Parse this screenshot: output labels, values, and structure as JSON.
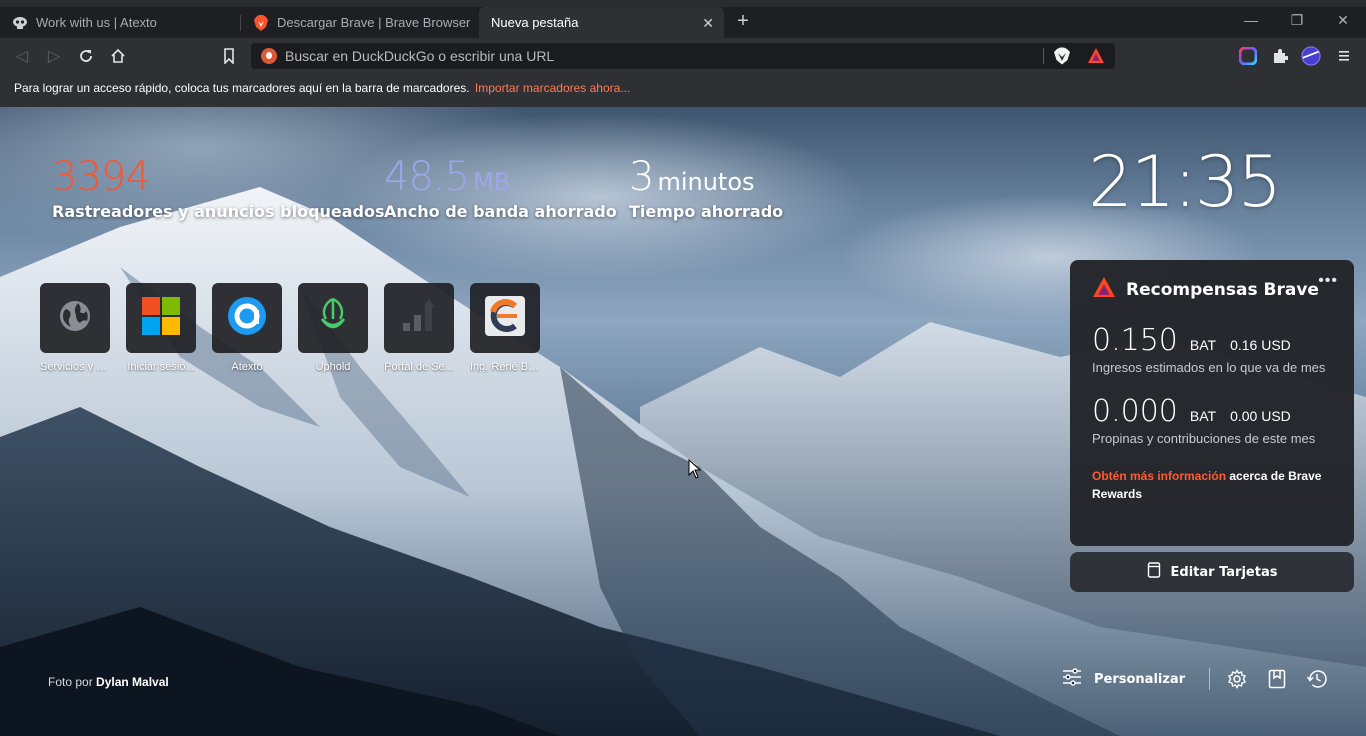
{
  "tabs": [
    {
      "title": "Work with us | Atexto",
      "icon": "atexto-mask-icon"
    },
    {
      "title": "Descargar Brave | Brave Browser",
      "icon": "brave-lion-icon"
    },
    {
      "title": "Nueva pestaña",
      "icon": "",
      "active": true
    }
  ],
  "toolbar": {
    "search_placeholder": "Buscar en DuckDuckGo o escribir una URL"
  },
  "bookmarks_bar": {
    "hint": "Para lograr un acceso rápido, coloca tus marcadores aquí en la barra de marcadores.",
    "import_link": "Importar marcadores ahora..."
  },
  "stats": {
    "trackers": {
      "value": "3394",
      "label": "Rastreadores y anuncios bloqueados",
      "color": "#fb542b"
    },
    "bandwidth": {
      "value": "48.5",
      "unit": "MB",
      "label": "Ancho de banda ahorrado",
      "color": "#a0a5eb"
    },
    "time": {
      "value": "3",
      "unit": "minutos",
      "label": "Tiempo ahorrado",
      "color": "#ffffff"
    }
  },
  "clock": "21:35",
  "top_sites": [
    {
      "label": "Servicios y T...",
      "icon": "globe-icon"
    },
    {
      "label": "Iniciar sesió...",
      "icon": "microsoft-icon"
    },
    {
      "label": "Atexto",
      "icon": "atexto-icon"
    },
    {
      "label": "Uphold",
      "icon": "uphold-icon"
    },
    {
      "label": "Portal de Se...",
      "icon": "bars-icon"
    },
    {
      "label": "Ing. René Blas",
      "icon": "c-logo-icon"
    }
  ],
  "rewards": {
    "title": "Recompensas Brave",
    "earnings": {
      "amount": "0.150",
      "currency": "BAT",
      "usd": "0.16 USD",
      "label": "Ingresos estimados en lo que va de mes"
    },
    "tips": {
      "amount": "0.000",
      "currency": "BAT",
      "usd": "0.00 USD",
      "label": "Propinas y contribuciones de este mes"
    },
    "info_link": "Obtén más información",
    "info_text": " acerca de Brave Rewards",
    "accent": "#ff5b34"
  },
  "edit_cards": "Editar Tarjetas",
  "photo_credit": {
    "prefix": "Foto por ",
    "author": "Dylan Malval"
  },
  "footer": {
    "personalize": "Personalizar"
  }
}
